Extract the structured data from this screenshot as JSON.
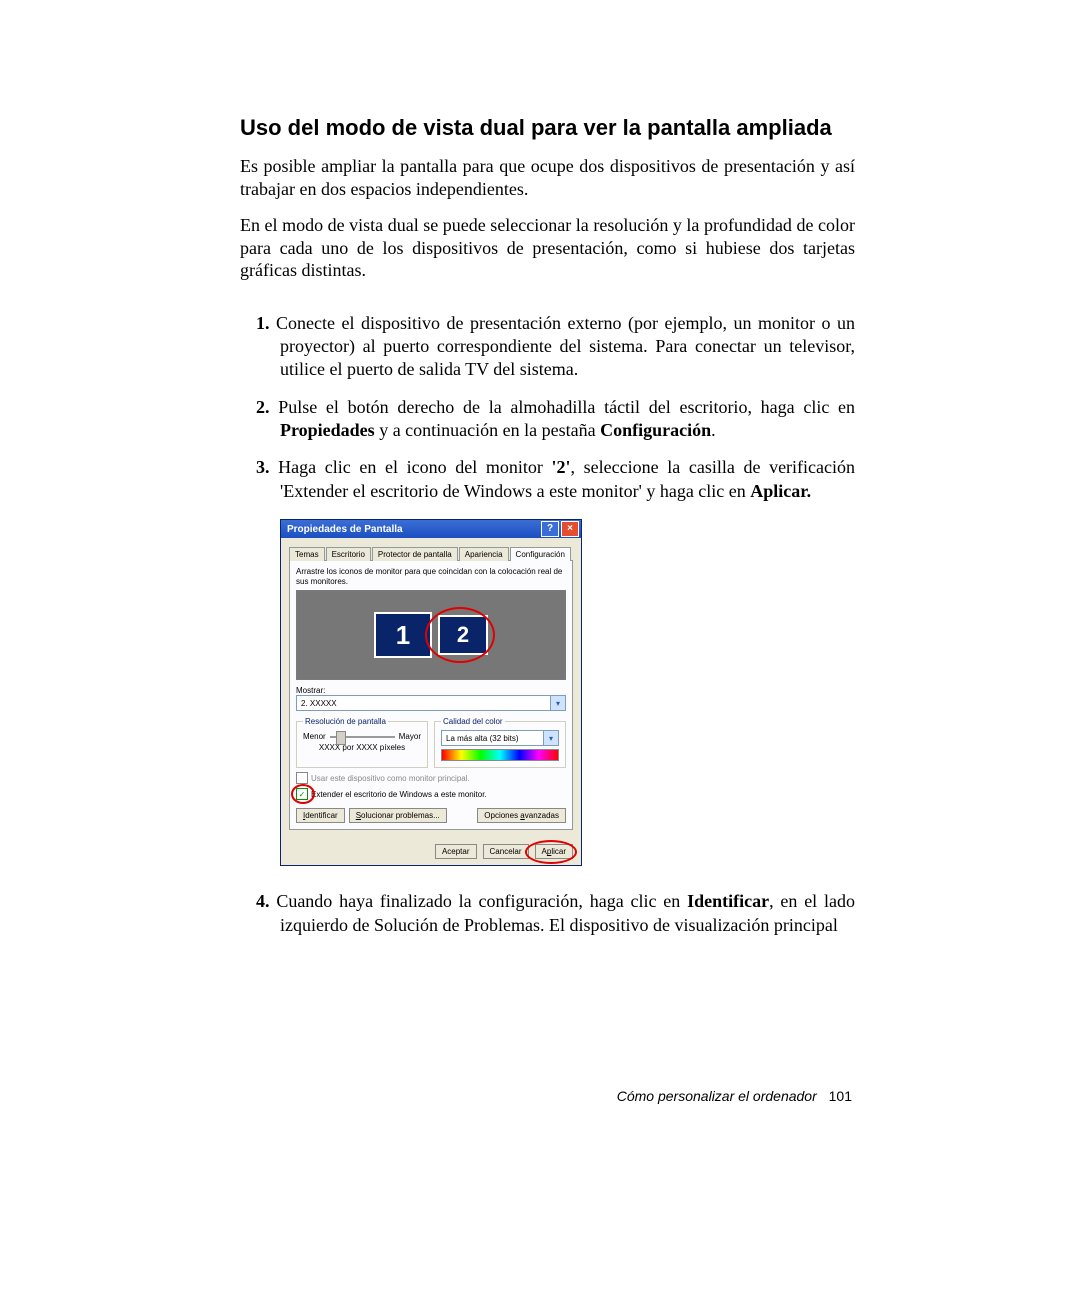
{
  "heading": "Uso del modo de vista dual para ver la pantalla ampliada",
  "intro1": "Es posible ampliar la pantalla para que ocupe dos dispositivos de presentación y así trabajar en dos espacios independientes.",
  "intro2": "En el modo de vista dual se puede seleccionar la resolución y la profundidad de color para cada uno de los dispositivos de presentación, como si hubiese dos tarjetas gráficas distintas.",
  "steps": {
    "n1": "1.",
    "s1": "Conecte el dispositivo de presentación externo (por ejemplo, un monitor o un proyector) al puerto correspondiente del sistema. Para conectar un televisor, utilice el puerto de salida TV del sistema.",
    "n2": "2.",
    "s2a": "Pulse el botón derecho de la almohadilla táctil del escritorio, haga clic en ",
    "s2b_bold_prop": "Propiedades",
    "s2c": " y a continuación en la pestaña ",
    "s2d_bold_conf": "Configuración",
    "s2e": ".",
    "n3": "3.",
    "s3a": "Haga clic en el icono del monitor ",
    "s3b_bold_two": "'2'",
    "s3c": ", seleccione la casilla de verificación 'Extender el escritorio de Windows a este monitor' y haga clic en ",
    "s3d_bold_apply": "Aplicar.",
    "n4": "4.",
    "s4a": "Cuando haya finalizado la configuración, haga clic en ",
    "s4b_bold_ident": "Identificar",
    "s4c": ", en el lado izquierdo de Solución de Problemas. El dispositivo de visualización principal"
  },
  "dialog": {
    "title": "Propiedades de Pantalla",
    "tabs": [
      "Temas",
      "Escritorio",
      "Protector de pantalla",
      "Apariencia",
      "Configuración"
    ],
    "instruction": "Arrastre los iconos de monitor para que coincidan con la colocación real de sus monitores.",
    "mon1": "1",
    "mon2": "2",
    "display_label": "Mostrar:",
    "display_value": "2. XXXXX",
    "res_legend": "Resolución de pantalla",
    "res_less": "Menor",
    "res_more": "Mayor",
    "res_value": "XXXX por XXXX píxeles",
    "color_legend": "Calidad del color",
    "color_value": "La más alta (32 bits)",
    "chk_primary": "Usar este dispositivo como monitor principal.",
    "chk_extend": "Extender el escritorio de Windows a este monitor.",
    "btn_identify": "Identificar",
    "btn_identify_u": "I",
    "btn_trouble": "Solucionar problemas...",
    "btn_trouble_u": "S",
    "btn_advanced": "Opciones avanzadas",
    "btn_advanced_u": "a",
    "btn_ok": "Aceptar",
    "btn_cancel": "Cancelar",
    "btn_apply": "Aplicar",
    "btn_apply_u": "p"
  },
  "footer": {
    "section": "Cómo personalizar el ordenador",
    "page": "101"
  }
}
